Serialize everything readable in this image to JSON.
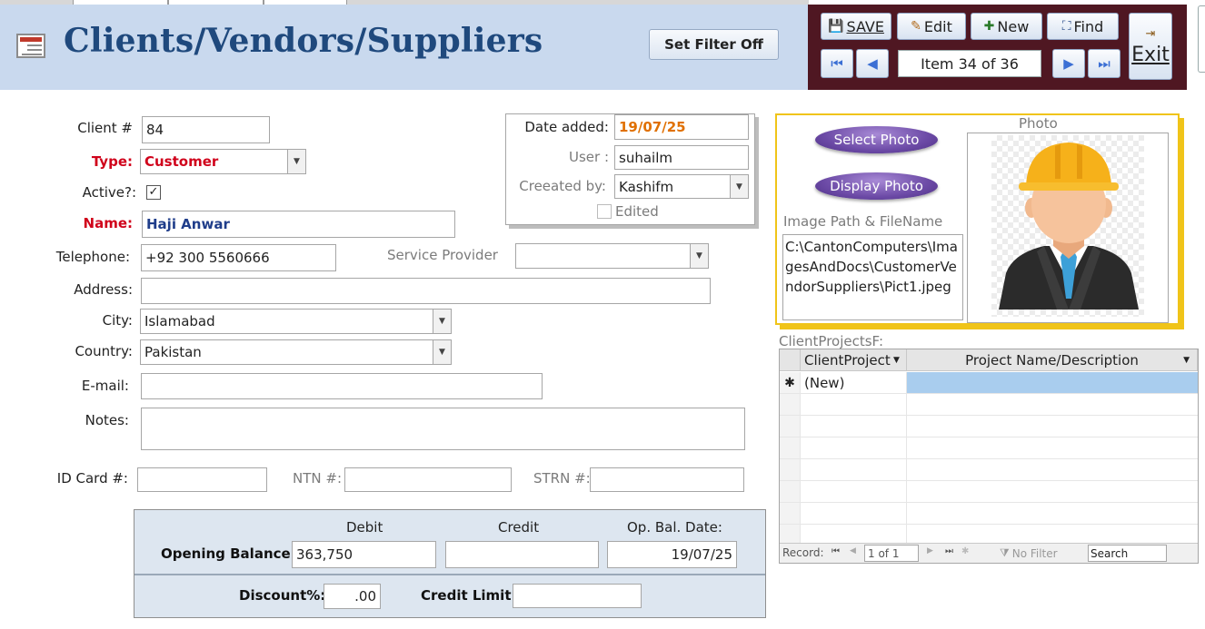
{
  "header": {
    "title": "Clients/Vendors/Suppliers",
    "filter_button": "Set Filter Off"
  },
  "nav": {
    "save": "SAVE",
    "edit": "Edit",
    "new": "New",
    "find": "Find",
    "counter": "Item 34 of 36",
    "exit": "Exit"
  },
  "form": {
    "client_no_label": "Client #",
    "client_no": "84",
    "type_label": "Type:",
    "type": "Customer",
    "active_label": "Active?:",
    "active_mark": "✓",
    "name_label": "Name:",
    "name": "Haji Anwar",
    "telephone_label": "Telephone:",
    "telephone": "+92 300 5560666",
    "service_provider_label": "Service Provider",
    "service_provider": "",
    "address_label": "Address:",
    "address": "",
    "city_label": "City:",
    "city": "Islamabad",
    "country_label": "Country:",
    "country": "Pakistan",
    "email_label": "E-mail:",
    "email": "",
    "notes_label": "Notes:",
    "notes": "",
    "id_card_label": "ID Card #:",
    "id_card": "",
    "ntn_label": "NTN #:",
    "ntn": "",
    "strn_label": "STRN #:",
    "strn": ""
  },
  "audit": {
    "date_added_label": "Date added:",
    "date_added": "19/07/25",
    "user_label": "User :",
    "user": "suhailm",
    "created_by_label": "Creeated by:",
    "created_by": "Kashifm",
    "edited_label": "Edited"
  },
  "photo": {
    "select_button": "Select Photo",
    "display_button": "Display Photo",
    "photo_label": "Photo",
    "path_label": "Image Path & FileName",
    "path": "C:\\CantonComputers\\ImagesAndDocs\\CustomerVendorSuppliers\\Pict1.jpeg"
  },
  "subform": {
    "caption": "ClientProjectsF:",
    "columns": [
      "ClientProject",
      "Project Name/Description"
    ],
    "new_row_marker": "✱",
    "new_row_label": "(New)",
    "record_label": "Record:",
    "record_pos": "1 of 1",
    "no_filter": "No Filter",
    "search": "Search"
  },
  "balance": {
    "debit_label": "Debit",
    "credit_label": "Credit",
    "op_date_label": "Op. Bal. Date:",
    "opening_label": "Opening Balance:",
    "debit": "363,750",
    "credit": "",
    "op_date": "19/07/25",
    "discount_label": "Discount%:",
    "discount": ".00",
    "credit_limit_label": "Credit Limit:",
    "credit_limit": ""
  },
  "colors": {
    "header_band": "#c9d9ee",
    "title": "#1f497d",
    "nav_panel": "#4f1722",
    "required_label": "#d0021b",
    "photo_border": "#f0c419",
    "pill_button": "#6c4aa6",
    "balance_panel": "#dde6f0"
  }
}
